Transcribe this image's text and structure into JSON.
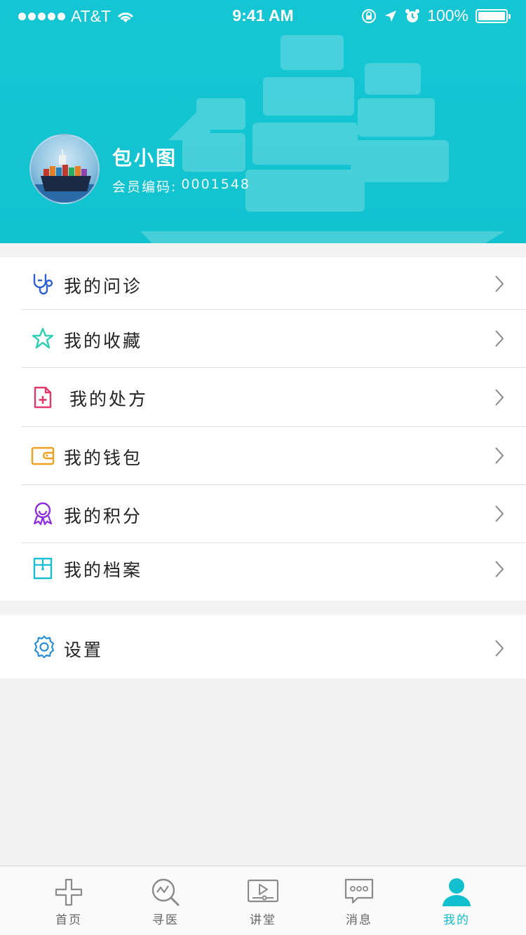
{
  "status_bar": {
    "carrier": "AT&T",
    "time": "9:41 AM",
    "battery": "100%"
  },
  "profile": {
    "name": "包小图",
    "member_label": "会员编码:",
    "member_id": "0001548"
  },
  "menu": [
    {
      "label": "我的问诊",
      "icon": "stethoscope-icon",
      "color": "#2d5fd6"
    },
    {
      "label": "我的收藏",
      "icon": "star-icon",
      "color": "#2fd0b4"
    },
    {
      "label": "我的处方",
      "icon": "prescription-icon",
      "color": "#e03a6a"
    },
    {
      "label": "我的钱包",
      "icon": "wallet-icon",
      "color": "#f0a020"
    },
    {
      "label": "我的积分",
      "icon": "medal-icon",
      "color": "#8a2be2"
    },
    {
      "label": "我的档案",
      "icon": "archive-icon",
      "color": "#16bfd0"
    }
  ],
  "settings": {
    "label": "设置",
    "icon": "gear-icon",
    "color": "#2a8fd6"
  },
  "tabs": [
    {
      "label": "首页",
      "icon": "home-cross-icon"
    },
    {
      "label": "寻医",
      "icon": "search-doctor-icon"
    },
    {
      "label": "讲堂",
      "icon": "video-lecture-icon"
    },
    {
      "label": "消息",
      "icon": "message-icon"
    },
    {
      "label": "我的",
      "icon": "profile-icon",
      "active": true
    }
  ],
  "colors": {
    "header": "#14c6d3",
    "accent": "#12bfcf",
    "background": "#f3f3f3"
  }
}
